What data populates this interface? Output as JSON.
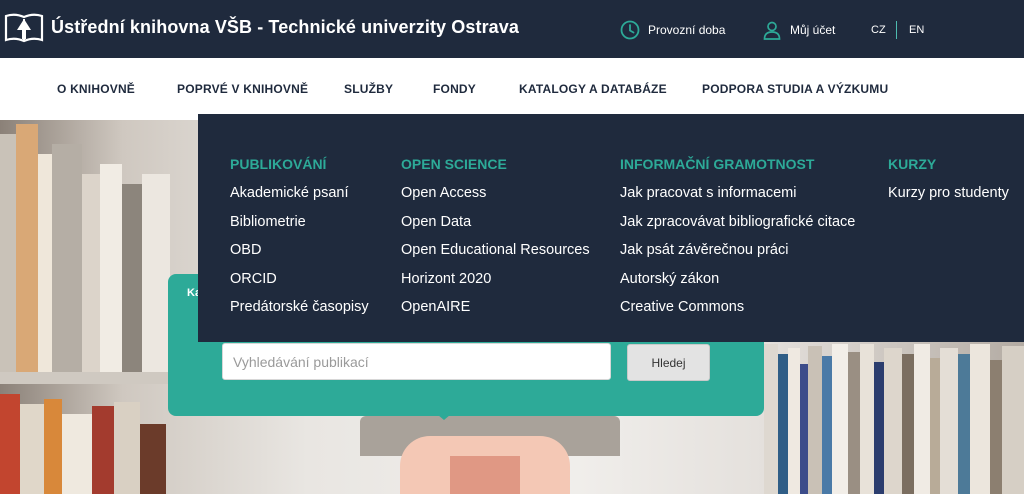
{
  "header": {
    "title": "Ústřední knihovna VŠB - Technické univerzity Ostrava",
    "links": {
      "hours": "Provozní doba",
      "account": "Můj účet"
    },
    "languages": [
      "CZ",
      "EN"
    ]
  },
  "nav": {
    "items": [
      "O KNIHOVNĚ",
      "POPRVÉ V KNIHOVNĚ",
      "SLUŽBY",
      "FONDY",
      "KATALOGY A DATABÁZE",
      "PODPORA STUDIA A VÝZKUMU"
    ]
  },
  "dropdown": {
    "columns": [
      {
        "heading": "PUBLIKOVÁNÍ",
        "items": [
          "Akademické psaní",
          "Bibliometrie",
          "OBD",
          "ORCID",
          "Predátorské časopisy"
        ]
      },
      {
        "heading": "OPEN SCIENCE",
        "items": [
          "Open Access",
          "Open Data",
          "Open Educational Resources",
          "Horizont 2020",
          "OpenAIRE"
        ]
      },
      {
        "heading": "INFORMAČNÍ GRAMOTNOST",
        "items": [
          "Jak pracovat s informacemi",
          "Jak zpracovávat bibliografické citace",
          "Jak psát závěrečnou práci",
          "Autorský zákon",
          "Creative Commons"
        ]
      },
      {
        "heading": "KURZY",
        "items": [
          "Kurzy pro studenty"
        ]
      }
    ]
  },
  "search": {
    "label_fragment": "Ka",
    "placeholder": "Vyhledávání publikací",
    "button": "Hledej"
  },
  "icons": {
    "logo": "open-book-logo",
    "hours": "clock-icon",
    "account": "user-icon"
  },
  "colors": {
    "dark": "#1f2a3d",
    "accent": "#2daa98",
    "white": "#ffffff"
  }
}
